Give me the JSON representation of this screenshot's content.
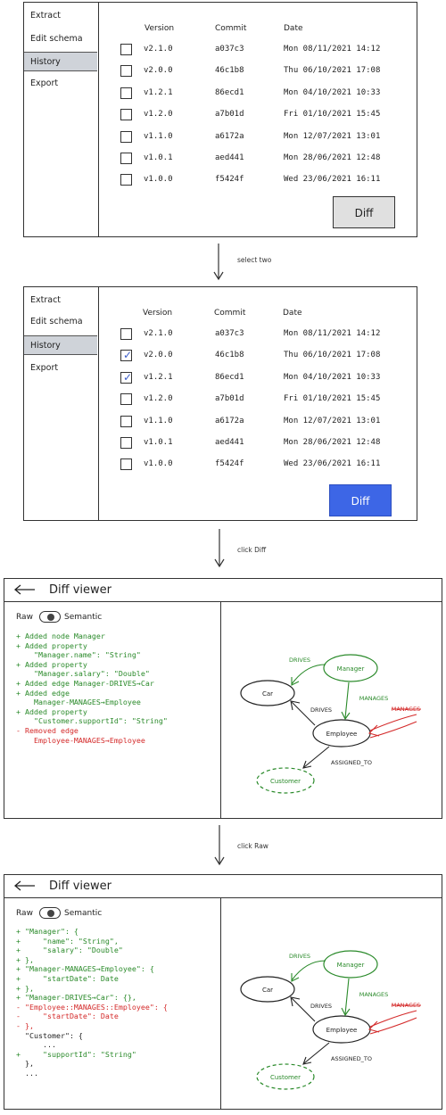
{
  "sidebar": {
    "items": [
      "Extract",
      "Edit schema",
      "History",
      "Export"
    ],
    "active": "History"
  },
  "history": {
    "columns": {
      "version": "Version",
      "commit": "Commit",
      "date": "Date"
    },
    "rows": [
      {
        "version": "v2.1.0",
        "commit": "a037c3",
        "date": "Mon 08/11/2021 14:12"
      },
      {
        "version": "v2.0.0",
        "commit": "46c1b8",
        "date": "Thu 06/10/2021 17:08"
      },
      {
        "version": "v1.2.1",
        "commit": "86ecd1",
        "date": "Mon 04/10/2021 10:33"
      },
      {
        "version": "v1.2.0",
        "commit": "a7b01d",
        "date": "Fri 01/10/2021 15:45"
      },
      {
        "version": "v1.1.0",
        "commit": "a6172a",
        "date": "Mon 12/07/2021 13:01"
      },
      {
        "version": "v1.0.1",
        "commit": "aed441",
        "date": "Mon 28/06/2021 12:48"
      },
      {
        "version": "v1.0.0",
        "commit": "f5424f",
        "date": "Wed 23/06/2021 16:11"
      }
    ],
    "checked_after_select": [
      1,
      2
    ],
    "diff_label": "Diff"
  },
  "steps": {
    "select": "select two",
    "click_diff": "click Diff",
    "click_raw": "click Raw"
  },
  "viewer": {
    "title": "Diff viewer",
    "toggle": {
      "left": "Raw",
      "right": "Semantic"
    },
    "colors": {
      "added": "#2a8a2a",
      "removed": "#d42a2a"
    },
    "semantic_lines": [
      {
        "type": "add",
        "text": "+ Added node Manager"
      },
      {
        "type": "add",
        "text": "+ Added property"
      },
      {
        "type": "add",
        "text": "    \"Manager.name\": \"String\""
      },
      {
        "type": "add",
        "text": "+ Added property"
      },
      {
        "type": "add",
        "text": "    \"Manager.salary\": \"Double\""
      },
      {
        "type": "add",
        "text": "+ Added edge Manager-DRIVES→Car"
      },
      {
        "type": "add",
        "text": "+ Added edge"
      },
      {
        "type": "add",
        "text": "    Manager-MANAGES→Employee"
      },
      {
        "type": "add",
        "text": "+ Added property"
      },
      {
        "type": "add",
        "text": "    \"Customer.supportId\": \"String\""
      },
      {
        "type": "rem",
        "text": "- Removed edge"
      },
      {
        "type": "rem",
        "text": "    Employee-MANAGES→Employee"
      }
    ],
    "raw_lines": [
      {
        "type": "add",
        "text": "+ \"Manager\": {"
      },
      {
        "type": "add",
        "text": "+     \"name\": \"String\","
      },
      {
        "type": "add",
        "text": "+     \"salary\": \"Double\""
      },
      {
        "type": "add",
        "text": "+ },"
      },
      {
        "type": "add",
        "text": "+ \"Manager-MANAGES→Employee\": {"
      },
      {
        "type": "add",
        "text": "+     \"startDate\": Date"
      },
      {
        "type": "add",
        "text": "+ },"
      },
      {
        "type": "add",
        "text": "+ \"Manager-DRIVES→Car\": {},"
      },
      {
        "type": "rem",
        "text": "- \"Employee::MANAGES::Employee\": {"
      },
      {
        "type": "rem",
        "text": "-     \"startDate\": Date"
      },
      {
        "type": "rem",
        "text": "- },"
      },
      {
        "type": "ctx",
        "text": "  \"Customer\": {"
      },
      {
        "type": "ctx",
        "text": "      ..."
      },
      {
        "type": "add",
        "text": "+     \"supportId\": \"String\""
      },
      {
        "type": "ctx",
        "text": "  },"
      },
      {
        "type": "ctx",
        "text": "  ..."
      }
    ],
    "graph": {
      "nodes": {
        "manager": "Manager",
        "car": "Car",
        "employee": "Employee",
        "customer": "Customer"
      },
      "edges": {
        "drives_added": "DRIVES",
        "manages_added": "MANAGES",
        "drives": "DRIVES",
        "assigned_to": "ASSIGNED_TO",
        "manages_removed": "MANAGES"
      }
    }
  }
}
